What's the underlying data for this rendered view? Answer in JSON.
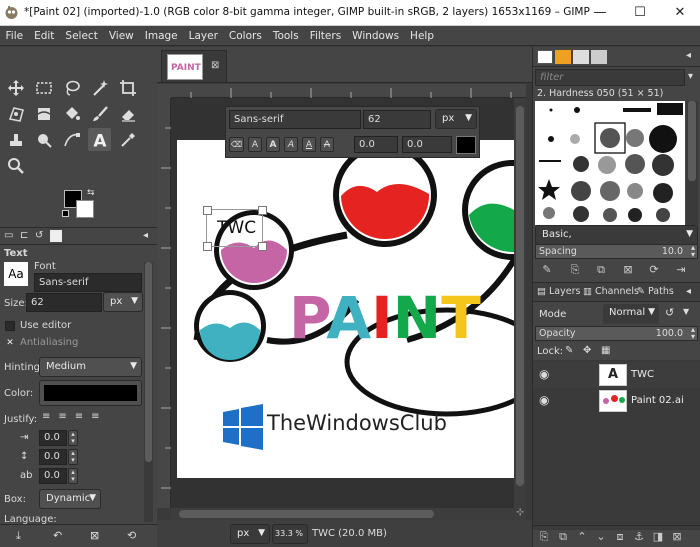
{
  "window": {
    "title": "*[Paint 02] (imported)-1.0 (RGB color 8-bit gamma integer, GIMP built-in sRGB, 2 layers) 1653x1169 – GIMP",
    "minimize": "—",
    "maximize": "☐",
    "close": "✕"
  },
  "menu": [
    "File",
    "Edit",
    "Select",
    "View",
    "Image",
    "Layer",
    "Colors",
    "Tools",
    "Filters",
    "Windows",
    "Help"
  ],
  "tool_options": {
    "header": "Text",
    "font_label": "Font",
    "font_preview": "Aa",
    "font_value": "Sans-serif",
    "size_label": "Size:",
    "size_value": "62",
    "size_unit": "px",
    "use_editor": "Use editor",
    "antialiasing": "Antialiasing",
    "hinting_label": "Hinting:",
    "hinting_value": "Medium",
    "color_label": "Color:",
    "color_value": "#000000",
    "justify_label": "Justify:",
    "indent_value": "0.0",
    "line_spacing_value": "0.0",
    "letter_spacing_value": "0.0",
    "box_label": "Box:",
    "box_value": "Dynamic",
    "language_label": "Language:"
  },
  "text_toolbox": {
    "font": "Sans-serif",
    "size": "62",
    "unit": "px",
    "baseline": "0.0",
    "kerning": "0.0",
    "style_buttons": [
      "A",
      "A",
      "A",
      "A",
      "A"
    ]
  },
  "canvas": {
    "typed_text": "TWC",
    "logo_text": "PAINT",
    "watermark": "TheWindowsClub",
    "tab_logo": "PAINT"
  },
  "statusbar": {
    "unit": "px",
    "zoom": "33.3 %",
    "info": "TWC (20.0 MB)"
  },
  "brushes": {
    "filter_placeholder": "filter",
    "current": "2. Hardness 050 (51 × 51)",
    "preset": "Basic,",
    "spacing_label": "Spacing",
    "spacing_value": "10.0"
  },
  "layers": {
    "tabs": [
      "Layers",
      "Channels",
      "Paths"
    ],
    "mode_label": "Mode",
    "mode_value": "Normal",
    "opacity_label": "Opacity",
    "opacity_value": "100.0",
    "lock_label": "Lock:",
    "items": [
      {
        "name": "TWC",
        "visible": true,
        "selected": true
      },
      {
        "name": "Paint 02.ai",
        "visible": true,
        "selected": false
      }
    ]
  },
  "colors": {
    "foreground": "#000000",
    "background": "#ffffff",
    "paint_magenta": "#c565a6",
    "paint_red": "#e52421",
    "paint_green": "#13a84a",
    "paint_teal": "#3fb1c0",
    "paint_yellow": "#f4c51b",
    "twc_blue": "#1e6fc8"
  }
}
